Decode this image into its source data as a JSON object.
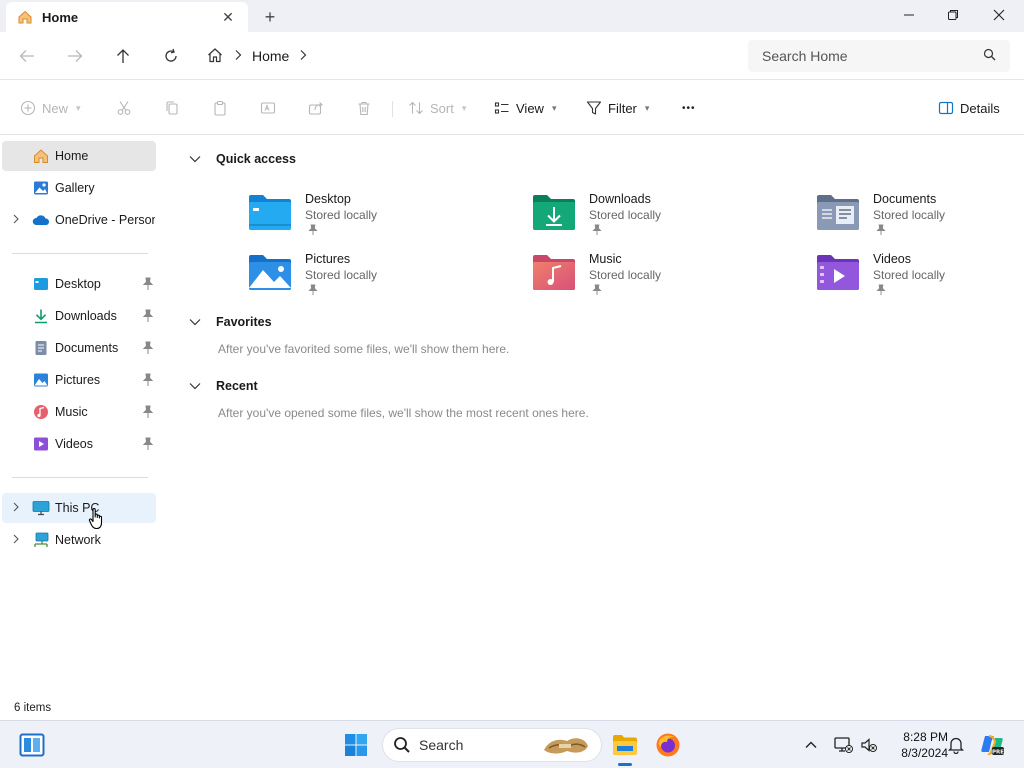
{
  "window": {
    "tab_title": "Home",
    "new_tab_label": "+"
  },
  "address": {
    "crumbs": [
      "Home"
    ],
    "search_placeholder": "Search Home"
  },
  "toolbar": {
    "new_label": "New",
    "sort_label": "Sort",
    "view_label": "View",
    "filter_label": "Filter",
    "more_label": "•••",
    "details_label": "Details"
  },
  "sidebar": {
    "top": [
      {
        "label": "Home",
        "icon": "home-icon"
      },
      {
        "label": "Gallery",
        "icon": "gallery-icon"
      },
      {
        "label": "OneDrive - Personal",
        "icon": "onedrive-icon"
      }
    ],
    "pinned": [
      {
        "label": "Desktop",
        "icon": "desktop-folder-icon"
      },
      {
        "label": "Downloads",
        "icon": "downloads-folder-icon"
      },
      {
        "label": "Documents",
        "icon": "documents-folder-icon"
      },
      {
        "label": "Pictures",
        "icon": "pictures-folder-icon"
      },
      {
        "label": "Music",
        "icon": "music-folder-icon"
      },
      {
        "label": "Videos",
        "icon": "videos-folder-icon"
      }
    ],
    "bottom": [
      {
        "label": "This PC",
        "icon": "this-pc-icon"
      },
      {
        "label": "Network",
        "icon": "network-icon"
      }
    ]
  },
  "main": {
    "quick_access": {
      "title": "Quick access",
      "items": [
        {
          "name": "Desktop",
          "sub": "Stored locally",
          "icon": "desktop-folder-icon"
        },
        {
          "name": "Downloads",
          "sub": "Stored locally",
          "icon": "downloads-folder-icon"
        },
        {
          "name": "Documents",
          "sub": "Stored locally",
          "icon": "documents-folder-icon"
        },
        {
          "name": "Pictures",
          "sub": "Stored locally",
          "icon": "pictures-folder-icon"
        },
        {
          "name": "Music",
          "sub": "Stored locally",
          "icon": "music-folder-icon"
        },
        {
          "name": "Videos",
          "sub": "Stored locally",
          "icon": "videos-folder-icon"
        }
      ]
    },
    "favorites": {
      "title": "Favorites",
      "empty_text": "After you've favorited some files, we'll show them here."
    },
    "recent": {
      "title": "Recent",
      "empty_text": "After you've opened some files, we'll show the most recent ones here."
    }
  },
  "status": {
    "item_count": "6 items"
  },
  "taskbar": {
    "search_label": "Search",
    "time": "8:28 PM",
    "date": "8/3/2024"
  },
  "colors": {
    "accent": "#1a73c8",
    "selected_bg": "#e6e6e6",
    "hover_bg": "#e8f2fc"
  }
}
